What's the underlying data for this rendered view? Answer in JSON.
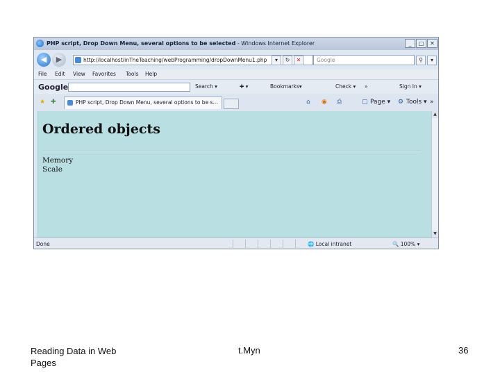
{
  "window": {
    "title_bold": "PHP script, Drop Down Menu, several options to be selected",
    "title_app": " - Windows Internet Explorer",
    "controls": {
      "minimize": "_",
      "maximize": "□",
      "close": "✕"
    }
  },
  "toolbar": {
    "back_icon": "back-arrow-icon",
    "forward_icon": "forward-arrow-icon",
    "address": "http://localhost/inTheTeaching/webProgramming/dropDownMenu1.php",
    "search_placeholder": "Google"
  },
  "menu": [
    "File",
    "Edit",
    "View",
    "Favorites",
    "Tools",
    "Help"
  ],
  "google_bar": {
    "logo": "Google",
    "items": [
      "Search ▾",
      "Bookmarks▾",
      "Check ▾",
      "Sign In ▾"
    ]
  },
  "tabs": [
    {
      "label": "PHP script, Drop Down Menu, several options to be s..."
    }
  ],
  "command_bar": {
    "page": "Page ▾",
    "tools": "Tools ▾"
  },
  "page": {
    "heading": "Ordered objects",
    "items": [
      "Memory",
      "Scale"
    ]
  },
  "status_bar": {
    "status": "Done",
    "zone": "Local intranet",
    "zoom": "100%"
  },
  "slide_footer": {
    "left": "Reading Data in Web Pages",
    "center": "t.Myn",
    "page_number": "36"
  }
}
